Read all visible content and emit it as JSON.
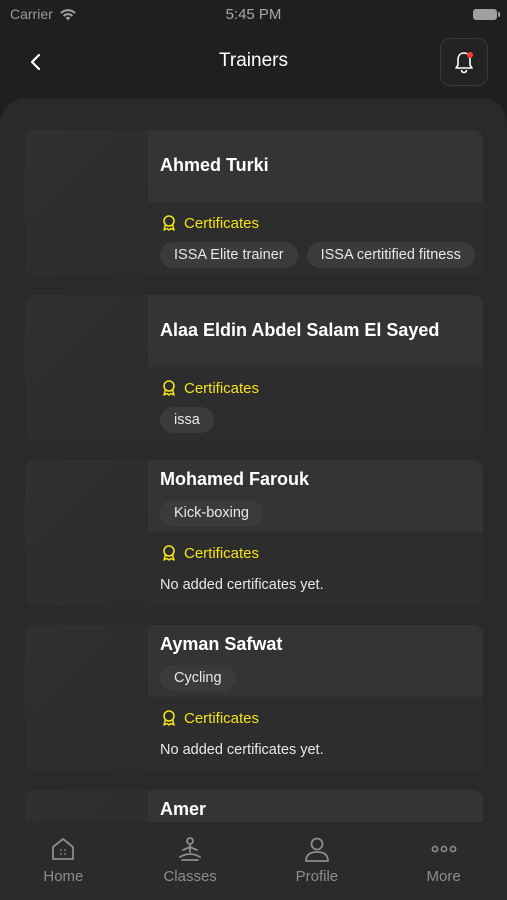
{
  "status": {
    "carrier": "Carrier",
    "time": "5:45 PM"
  },
  "header": {
    "title": "Trainers",
    "back_icon": "chevron-left-icon",
    "bell_icon": "bell-icon"
  },
  "trainers": [
    {
      "name": "Ahmed Turki",
      "specialty": null,
      "cert_label": "Certificates",
      "certificates": [
        "ISSA Elite trainer",
        "ISSA certitified fitness"
      ],
      "no_cert_text": null
    },
    {
      "name": "Alaa Eldin Abdel Salam El Sayed",
      "specialty": null,
      "cert_label": "Certificates",
      "certificates": [
        "issa"
      ],
      "no_cert_text": null
    },
    {
      "name": "Mohamed Farouk",
      "specialty": "Kick-boxing",
      "cert_label": "Certificates",
      "certificates": [],
      "no_cert_text": "No added certificates yet."
    },
    {
      "name": "Ayman Safwat",
      "specialty": "Cycling",
      "cert_label": "Certificates",
      "certificates": [],
      "no_cert_text": "No added certificates yet."
    },
    {
      "name": "Amer",
      "specialty": null,
      "cert_label": null,
      "certificates": [],
      "no_cert_text": null
    }
  ],
  "tabbar": {
    "items": [
      {
        "label": "Home",
        "icon": "home-icon"
      },
      {
        "label": "Classes",
        "icon": "meditation-icon"
      },
      {
        "label": "Profile",
        "icon": "user-icon"
      },
      {
        "label": "More",
        "icon": "more-dots-icon"
      }
    ]
  }
}
